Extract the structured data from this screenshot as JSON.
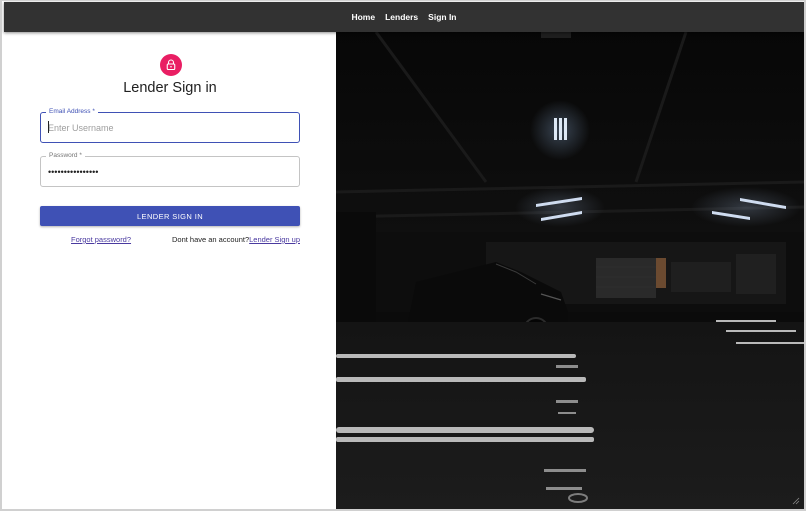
{
  "nav": {
    "items": [
      {
        "label": "Home"
      },
      {
        "label": "Lenders"
      },
      {
        "label": "Sign In"
      }
    ]
  },
  "login": {
    "avatar_icon": "lock-icon",
    "avatar_color": "#e91e63",
    "title": "Lender Sign in",
    "email": {
      "label": "Email Address *",
      "placeholder": "Enter Username",
      "value": ""
    },
    "password": {
      "label": "Password *",
      "value": "••••••••••••••••"
    },
    "submit_label": "Lender Sign In",
    "forgot_label": "Forgot password?",
    "signup_prompt": "Dont have an account?",
    "signup_label": "Lender Sign up"
  },
  "colors": {
    "nav_background": "#323232",
    "primary": "#3f51b5",
    "link": "#4a3aa0",
    "accent": "#e91e63"
  },
  "hero_image": {
    "description_icon": "parking-garage-photo"
  }
}
